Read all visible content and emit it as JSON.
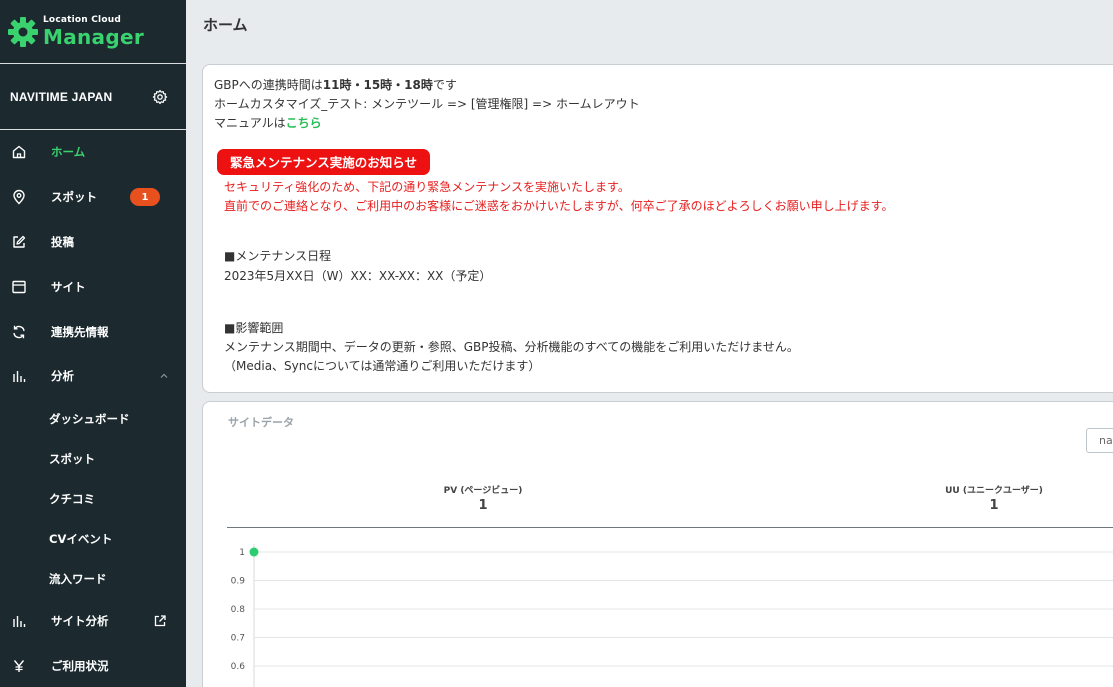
{
  "brand": {
    "small": "Location Cloud",
    "big": "Manager",
    "accent": "#39d26e"
  },
  "account": {
    "name": "NAVITIME JAPAN"
  },
  "nav": {
    "home": "ホーム",
    "spot": "スポット",
    "spot_badge": "1",
    "post": "投稿",
    "site": "サイト",
    "linked": "連携先情報",
    "analysis": "分析",
    "dashboard": "ダッシュボード",
    "analysis_spot": "スポット",
    "reviews": "クチコミ",
    "cv_event": "CVイベント",
    "inflow_word": "流入ワード",
    "site_analysis": "サイト分析",
    "usage": "ご利用状況"
  },
  "header": {
    "title": "ホーム"
  },
  "notice": {
    "line1_prefix": "GBPへの連携時間は",
    "line1_bold": "11時・15時・18時",
    "line1_suffix": "です",
    "line2": "ホームカスタマイズ_テスト: メンテツール => [管理権限] => ホームレアウト",
    "line3_prefix": "マニュアルは",
    "line3_link": "こちら",
    "alert_title": "緊急メンテナンス実施のお知らせ",
    "red1": "セキュリティ強化のため、下記の通り緊急メンテナンスを実施いたします。",
    "red2": "直前でのご連絡となり、ご利用中のお客様にご迷惑をおかけいたしますが、何卒ご了承のほどよろしくお願い申し上げます。",
    "schedule_heading": "■メンテナンス日程",
    "schedule_value": "2023年5月XX日（W）XX：XX-XX：XX（予定）",
    "scope_heading": "■影響範囲",
    "scope_line1": "メンテナンス期間中、データの更新・参照、GBP投稿、分析機能のすべての機能をご利用いただけません。",
    "scope_line2": "（Media、Syncについては通常通りご利用いただけます）"
  },
  "site_data": {
    "title": "サイトデータ",
    "select_value": "nav",
    "pv_label": "PV (ページビュー)",
    "pv_value": "1",
    "uu_label": "UU (ユニークユーザー)",
    "uu_value": "1"
  },
  "chart_data": {
    "type": "line",
    "title": "",
    "xlabel": "",
    "ylabel": "",
    "y_ticks": [
      "1",
      "0.9",
      "0.8",
      "0.7",
      "0.6"
    ],
    "ylim": [
      0.6,
      1
    ],
    "series": [
      {
        "values": [
          1
        ]
      }
    ],
    "grid": true,
    "point_color": "#2ecc71"
  }
}
